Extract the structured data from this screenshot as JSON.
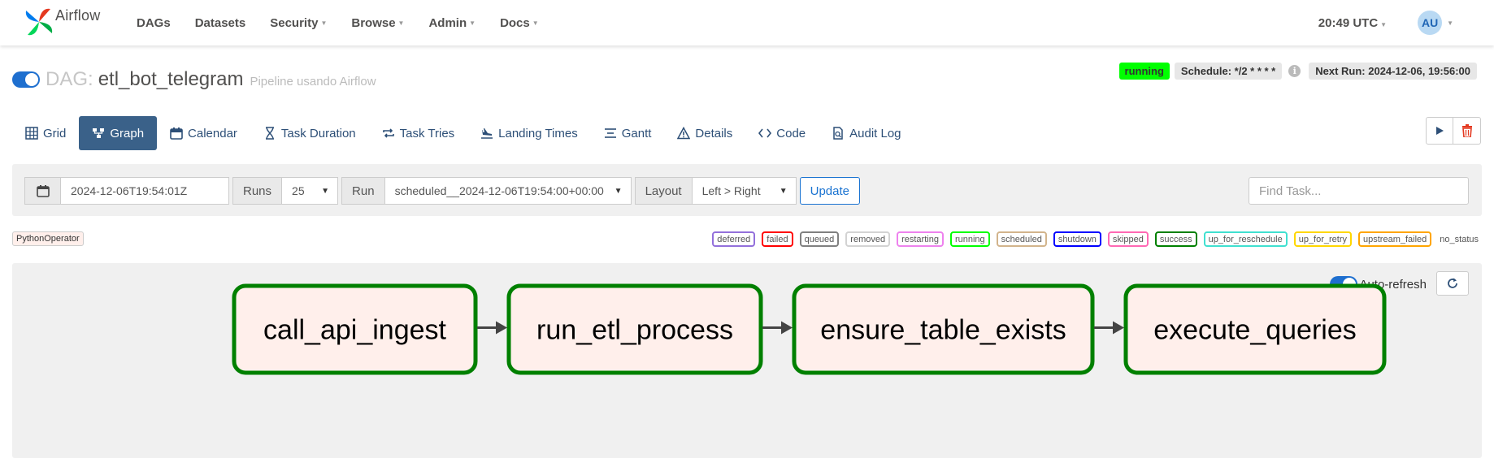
{
  "app": {
    "brand": "Airflow"
  },
  "nav": {
    "items": [
      {
        "label": "DAGs",
        "dropdown": false
      },
      {
        "label": "Datasets",
        "dropdown": false
      },
      {
        "label": "Security",
        "dropdown": true
      },
      {
        "label": "Browse",
        "dropdown": true
      },
      {
        "label": "Admin",
        "dropdown": true
      },
      {
        "label": "Docs",
        "dropdown": true
      }
    ],
    "time": "20:49 UTC",
    "user_initials": "AU"
  },
  "dag": {
    "prefix": "DAG:",
    "id": "etl_bot_telegram",
    "description": "Pipeline usando Airflow",
    "state": "running",
    "schedule": "Schedule: */2 * * * *",
    "next_run": "Next Run: 2024-12-06, 19:56:00",
    "paused": false
  },
  "tabs": [
    {
      "label": "Grid",
      "icon": "grid-icon"
    },
    {
      "label": "Graph",
      "icon": "graph-icon",
      "active": true
    },
    {
      "label": "Calendar",
      "icon": "calendar-icon"
    },
    {
      "label": "Task Duration",
      "icon": "hourglass-icon"
    },
    {
      "label": "Task Tries",
      "icon": "repeat-icon"
    },
    {
      "label": "Landing Times",
      "icon": "landing-icon"
    },
    {
      "label": "Gantt",
      "icon": "gantt-icon"
    },
    {
      "label": "Details",
      "icon": "warning-icon"
    },
    {
      "label": "Code",
      "icon": "code-icon"
    },
    {
      "label": "Audit Log",
      "icon": "audit-log-icon"
    }
  ],
  "filters": {
    "base_date": "2024-12-06T19:54:01Z",
    "runs_label": "Runs",
    "runs_value": "25",
    "run_label": "Run",
    "run_value": "scheduled__2024-12-06T19:54:00+00:00",
    "layout_label": "Layout",
    "layout_value": "Left > Right",
    "update_label": "Update",
    "find_task_placeholder": "Find Task..."
  },
  "legend": {
    "operator": "PythonOperator",
    "states": [
      {
        "label": "deferred",
        "color": "#9370db"
      },
      {
        "label": "failed",
        "color": "#ff0000"
      },
      {
        "label": "queued",
        "color": "#808080"
      },
      {
        "label": "removed",
        "color": "#d3d3d3"
      },
      {
        "label": "restarting",
        "color": "#ee82ee"
      },
      {
        "label": "running",
        "color": "#00ff00"
      },
      {
        "label": "scheduled",
        "color": "#d2b48c"
      },
      {
        "label": "shutdown",
        "color": "#0000ff"
      },
      {
        "label": "skipped",
        "color": "#ff69b4"
      },
      {
        "label": "success",
        "color": "#008000"
      },
      {
        "label": "up_for_reschedule",
        "color": "#40e0d0"
      },
      {
        "label": "up_for_retry",
        "color": "#ffd700"
      },
      {
        "label": "upstream_failed",
        "color": "#ffa500"
      }
    ],
    "no_status": "no_status"
  },
  "graph": {
    "auto_refresh_label": "Auto-refresh",
    "auto_refresh_on": true,
    "tasks": [
      {
        "id": "call_api_ingest",
        "state": "success"
      },
      {
        "id": "run_etl_process",
        "state": "success"
      },
      {
        "id": "ensure_table_exists",
        "state": "success"
      },
      {
        "id": "execute_queries",
        "state": "success"
      }
    ],
    "node_fill": "#ffefeb",
    "success_color": "#008000"
  }
}
